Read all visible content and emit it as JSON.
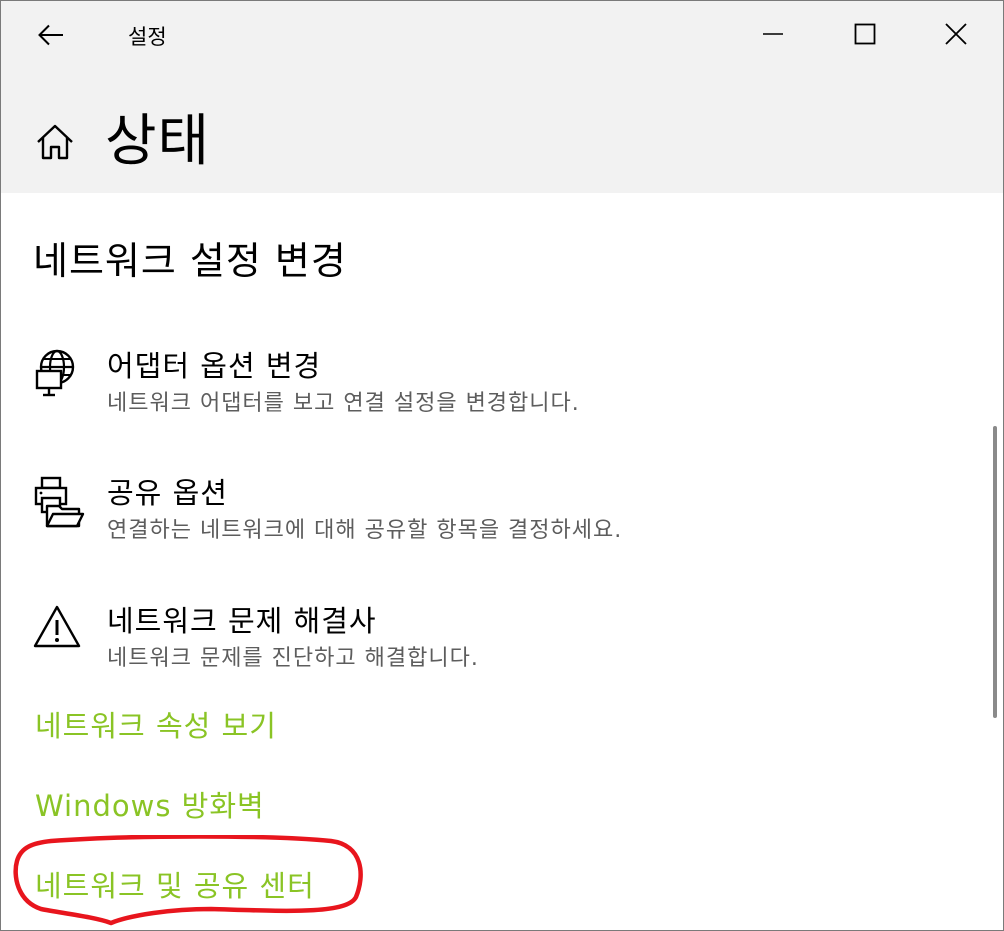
{
  "window": {
    "title": "설정",
    "back_icon": "arrow-left-icon",
    "controls": {
      "minimize_icon": "minimize-icon",
      "maximize_icon": "maximize-icon",
      "close_icon": "close-icon"
    }
  },
  "page": {
    "title": "상태",
    "home_icon": "home-icon"
  },
  "section": {
    "title": "네트워크 설정 변경"
  },
  "options": [
    {
      "icon": "globe-monitor-icon",
      "title": "어댑터 옵션 변경",
      "description": "네트워크 어댑터를 보고 연결 설정을 변경합니다."
    },
    {
      "icon": "printer-folder-icon",
      "title": "공유 옵션",
      "description": "연결하는 네트워크에 대해 공유할 항목을 결정하세요."
    },
    {
      "icon": "warning-icon",
      "title": "네트워크 문제 해결사",
      "description": "네트워크 문제를 진단하고 해결합니다."
    }
  ],
  "links": {
    "properties": "네트워크 속성 보기",
    "firewall": "Windows 방화벽",
    "sharing_center": "네트워크 및 공유 센터"
  },
  "colors": {
    "link": "#8ac425",
    "header_bg": "#f2f2f2",
    "highlight": "#e8151d",
    "description": "#5d5d5d"
  }
}
